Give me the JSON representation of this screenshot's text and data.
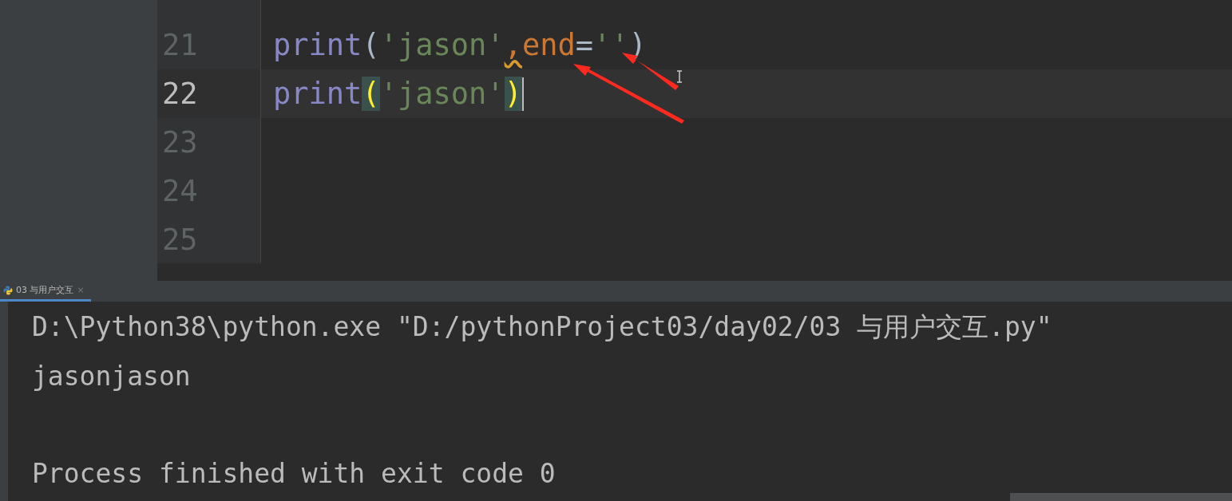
{
  "editor": {
    "lines": [
      {
        "number": "21",
        "current": false,
        "tokens": [
          {
            "text": "print",
            "kind": "builtin"
          },
          {
            "text": "(",
            "kind": "paren"
          },
          {
            "text": "'jason'",
            "kind": "string"
          },
          {
            "text": ",",
            "kind": "warning"
          },
          {
            "text": "end",
            "kind": "param"
          },
          {
            "text": "=",
            "kind": "paren"
          },
          {
            "text": "''",
            "kind": "string"
          },
          {
            "text": ")",
            "kind": "paren"
          }
        ]
      },
      {
        "number": "22",
        "current": true,
        "tokens": [
          {
            "text": "print",
            "kind": "builtin"
          },
          {
            "text": "(",
            "kind": "match"
          },
          {
            "text": "'jason'",
            "kind": "string"
          },
          {
            "text": ")",
            "kind": "match"
          }
        ]
      },
      {
        "number": "23",
        "current": false
      },
      {
        "number": "24",
        "current": false
      },
      {
        "number": "25",
        "current": false
      }
    ]
  },
  "run_panel": {
    "tab": {
      "label": "03 与用户交互",
      "close": "×",
      "selected": true
    },
    "output": [
      {
        "kind": "command",
        "text": "D:\\Python38\\python.exe \"D:/pythonProject03/day02/03 与用户交互.py\""
      },
      {
        "kind": "stdout",
        "text": "jasonjason"
      },
      {
        "kind": "exit",
        "text": "Process finished with exit code 0"
      }
    ]
  }
}
